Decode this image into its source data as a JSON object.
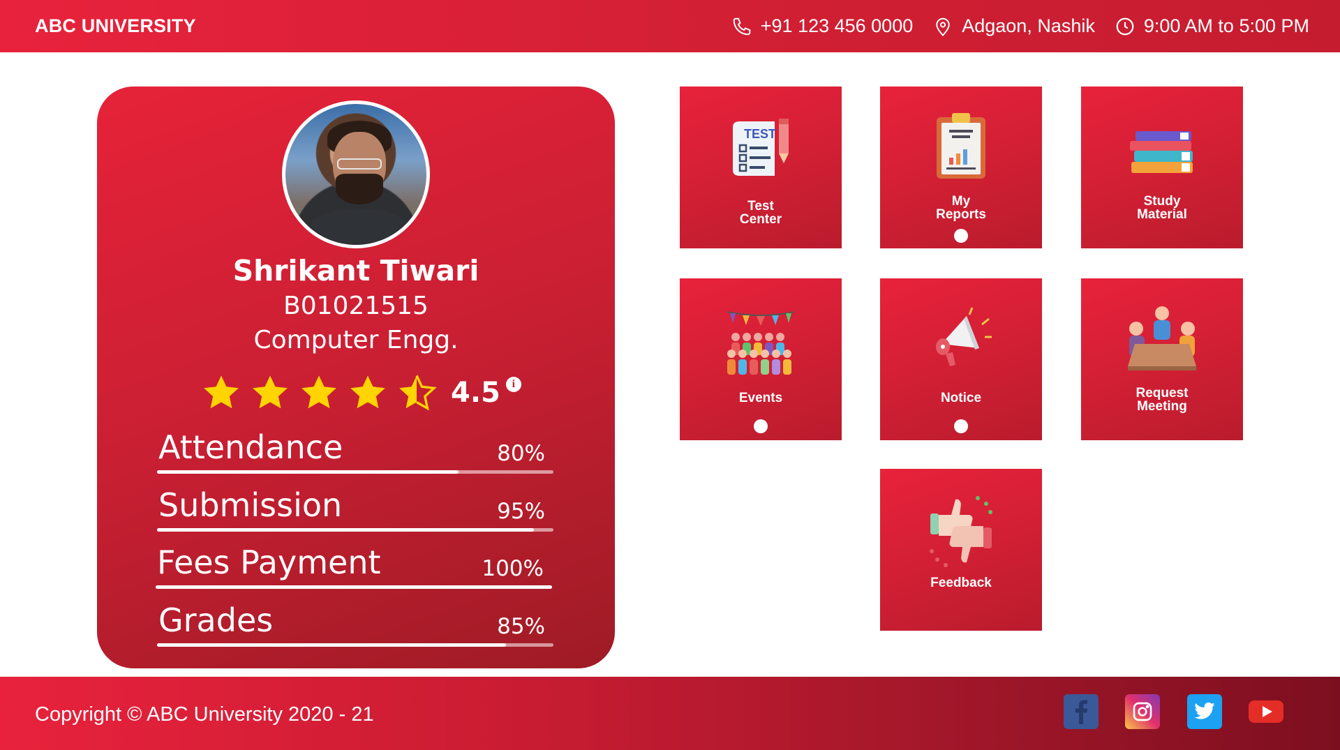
{
  "header": {
    "brand": "ABC UNIVERSITY",
    "phone": "+91 123 456 0000",
    "location": "Adgaon, Nashik",
    "hours": "9:00 AM to 5:00 PM"
  },
  "profile": {
    "name": "Shrikant Tiwari",
    "student_id": "B01021515",
    "department": "Computer Engg.",
    "rating": "4.5",
    "rating_value": 4.5,
    "rating_max": 5,
    "info_glyph": "i",
    "metrics": [
      {
        "label": "Attendance",
        "value": "80%",
        "fraction": 0.76
      },
      {
        "label": "Submission",
        "value": "95%",
        "fraction": 0.95
      },
      {
        "label": "Fees Payment",
        "value": "100%",
        "fraction": 1.0
      },
      {
        "label": "Grades",
        "value": "85%",
        "fraction": 0.88
      }
    ]
  },
  "tiles": [
    {
      "label": "Test\nCenter",
      "icon": "test-sheet-icon",
      "has_dot": false
    },
    {
      "label": "My\nReports",
      "icon": "report-clipboard-icon",
      "has_dot": true
    },
    {
      "label": "Study\nMaterial",
      "icon": "books-icon",
      "has_dot": false
    },
    {
      "label": "Events",
      "icon": "crowd-event-icon",
      "has_dot": true
    },
    {
      "label": "Notice",
      "icon": "megaphone-icon",
      "has_dot": true
    },
    {
      "label": "Request\nMeeting",
      "icon": "meeting-icon",
      "has_dot": false
    },
    {
      "label": "Feedback",
      "icon": "thumbs-feedback-icon",
      "has_dot": false
    }
  ],
  "footer": {
    "copyright": "Copyright © ABC University 2020 - 21",
    "social": [
      {
        "icon": "facebook-icon",
        "color": "#3b5998"
      },
      {
        "icon": "instagram-icon",
        "color": "#c13584"
      },
      {
        "icon": "twitter-icon",
        "color": "#1da1f2"
      },
      {
        "icon": "youtube-icon",
        "color": "#e52d27"
      }
    ]
  },
  "colors": {
    "primary": "#e8223c",
    "accent_star": "#ffd400"
  }
}
